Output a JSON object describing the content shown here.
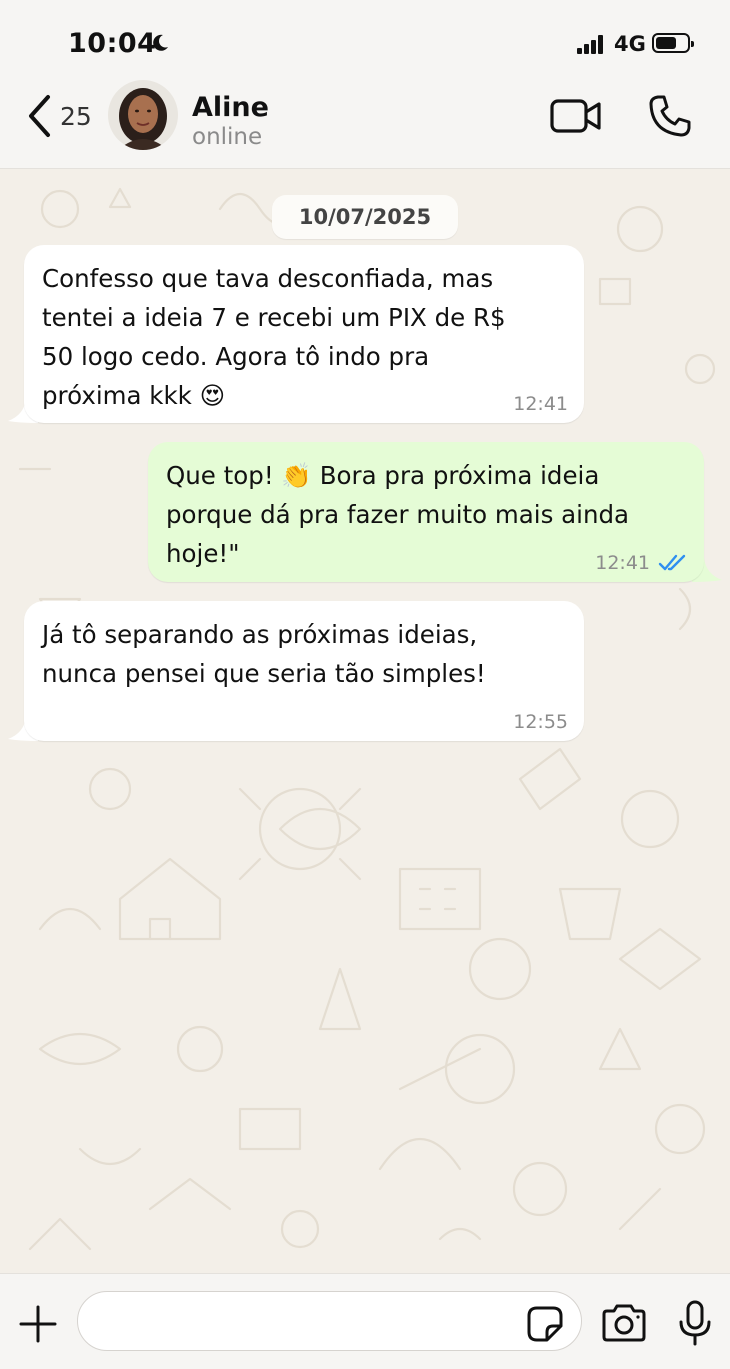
{
  "status_bar": {
    "time": "10:04",
    "network": "4G",
    "icons": [
      "moon-icon",
      "signal-icon",
      "battery-icon"
    ]
  },
  "header": {
    "back_count": "25",
    "contact_name": "Aline",
    "contact_status": "online",
    "icons": [
      "chevron-left-icon",
      "video-camera-icon",
      "phone-icon"
    ]
  },
  "chat": {
    "date_chip": "10/07/2025",
    "messages": [
      {
        "direction": "incoming",
        "text": "Confesso que tava desconfiada, mas\ntentei a ideia 7 e recebi um PIX de R$\n50 logo cedo. Agora tô indo pra\npróxima kkk 😍",
        "time": "12:41"
      },
      {
        "direction": "outgoing",
        "text": "Que top! 👏 Bora pra próxima ideia\nporque dá pra fazer muito mais ainda\nhoje!\"",
        "time": "12:41",
        "status_icon": "double-check-read-icon"
      },
      {
        "direction": "incoming",
        "text": "Já tô separando as próximas ideias,\nnunca pensei que seria tão simples!",
        "time": "12:55"
      }
    ]
  },
  "composer": {
    "input_value": "",
    "icons": [
      "plus-icon",
      "sticker-icon",
      "camera-icon",
      "microphone-icon"
    ]
  },
  "colors": {
    "incoming_bubble": "#ffffff",
    "outgoing_bubble": "#e5fcd6",
    "chat_background": "#f3efe8",
    "read_check": "#2f8ff0"
  }
}
